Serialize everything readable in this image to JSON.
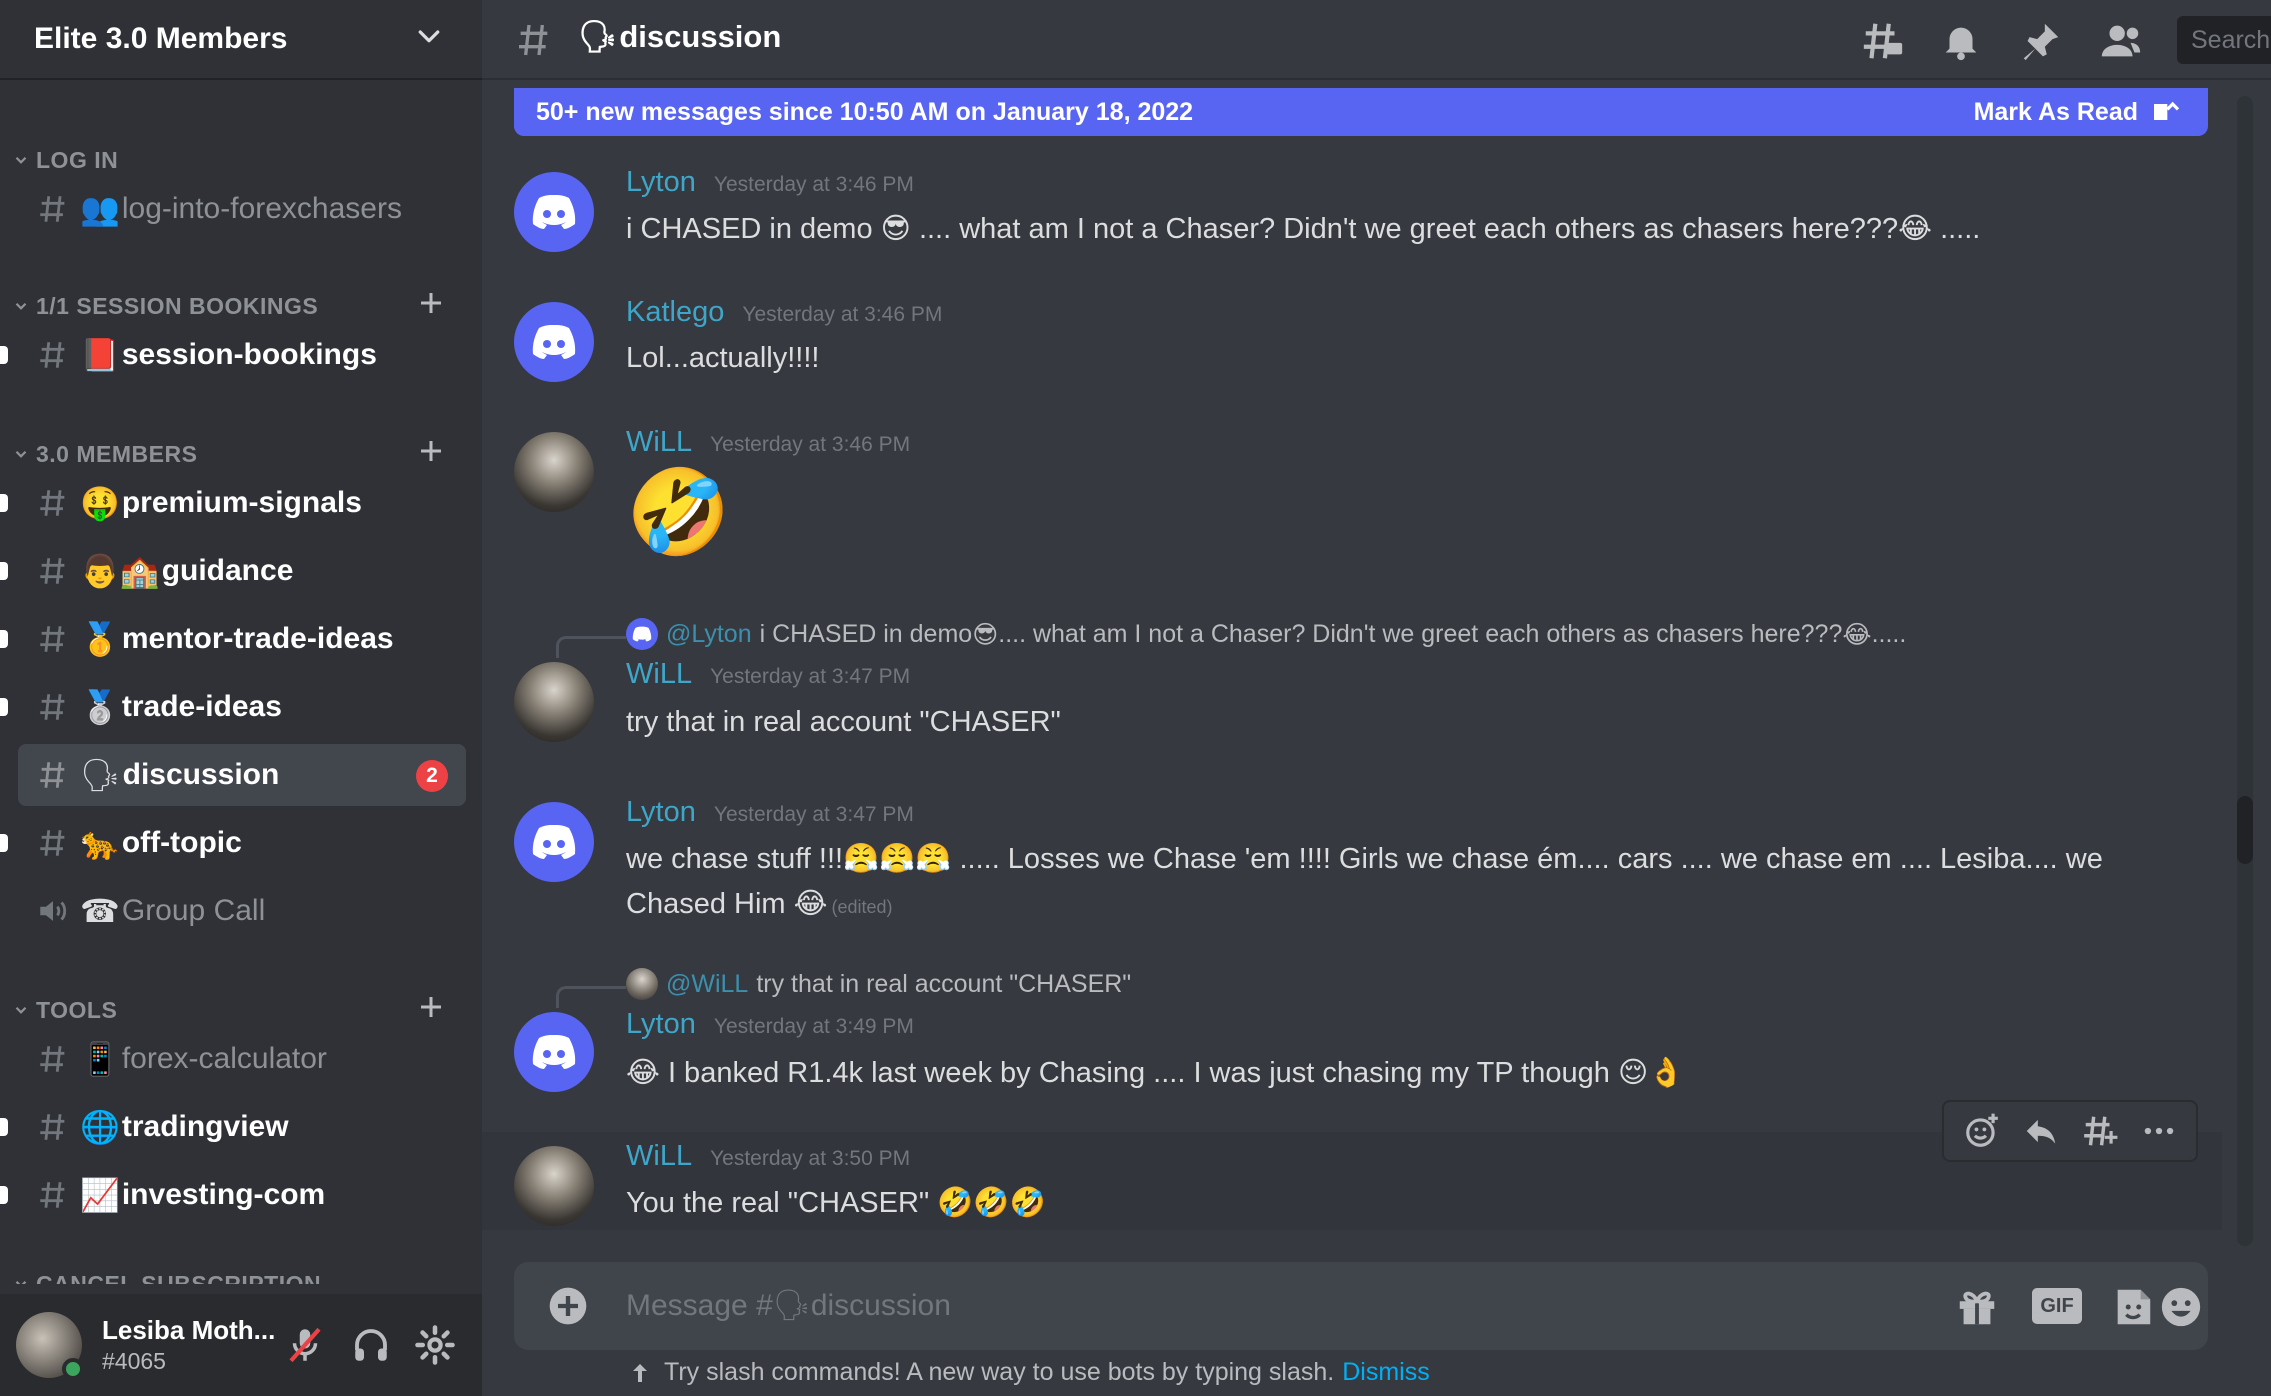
{
  "server": {
    "name": "Elite 3.0 Members"
  },
  "sidebar": {
    "categories": [
      {
        "label": "LOG IN"
      },
      {
        "label": "1/1 SESSION BOOKINGS"
      },
      {
        "label": "3.0 MEMBERS"
      },
      {
        "label": "TOOLS"
      },
      {
        "label": "CANCEL SUBSCRIPTION"
      }
    ],
    "channels": [
      {
        "emoji": "👥",
        "label": "log-into-forexchasers"
      },
      {
        "emoji": "📕",
        "label": "session-bookings"
      },
      {
        "emoji": "🤑",
        "label": "premium-signals"
      },
      {
        "emoji": "👨🏫",
        "label": "guidance"
      },
      {
        "emoji": "🥇",
        "label": "mentor-trade-ideas"
      },
      {
        "emoji": "🥈",
        "label": "trade-ideas"
      },
      {
        "emoji": "🗣",
        "label": "discussion",
        "badge": "2"
      },
      {
        "emoji": "🐆",
        "label": "off-topic"
      },
      {
        "emoji": "☎",
        "label": "Group Call"
      },
      {
        "emoji": "📱",
        "label": "forex-calculator"
      },
      {
        "emoji": "🌐",
        "label": "tradingview"
      },
      {
        "emoji": "📈",
        "label": "investing-com"
      }
    ]
  },
  "user": {
    "name": "Lesiba Moth...",
    "tag": "#4065",
    "status_color": "#3ba55d"
  },
  "header": {
    "channel_emoji": "🗣",
    "channel_name": "discussion",
    "search_placeholder": "Search",
    "icons": [
      "threads-icon",
      "bell-icon",
      "pin-icon",
      "members-icon"
    ]
  },
  "banner": {
    "text": "50+ new messages since 10:50 AM on January 18, 2022",
    "action": "Mark As Read"
  },
  "messages": [
    {
      "author": "Lyton",
      "time": "Yesterday at 3:46 PM",
      "text": [
        "i CHASED in demo ",
        "😎",
        " .... what am I not a Chaser? Didn't we greet each others as chasers here???",
        "😂",
        " ....."
      ]
    },
    {
      "author": "Katlego",
      "time": "Yesterday at 3:46 PM",
      "text": "Lol...actually!!!!"
    },
    {
      "author": "WiLL",
      "time": "Yesterday at 3:46 PM",
      "emoji": "🤣"
    },
    {
      "reply": {
        "user": "@Lyton",
        "parts": [
          "i CHASED in demo ",
          "😎",
          " .... what am I not a Chaser? Didn't we greet each others as chasers here???",
          "😂",
          " ....."
        ]
      },
      "author": "WiLL",
      "time": "Yesterday at 3:47 PM",
      "text": "try that in real account \"CHASER\""
    },
    {
      "author": "Lyton",
      "time": "Yesterday at 3:47 PM",
      "line1": [
        "we chase stuff !!!",
        "😤😤😤",
        " ..... Losses we Chase 'em !!!! Girls we chase ém.... cars .... we chase em .... Lesiba.... we"
      ],
      "line2": [
        "Chased Him ",
        "😂"
      ],
      "edited": "(edited)"
    },
    {
      "reply": {
        "user": "@WiLL",
        "text": "try that in real account \"CHASER\""
      },
      "author": "Lyton",
      "time": "Yesterday at 3:49 PM",
      "text": [
        "😂",
        " I banked R1.4k last week by Chasing .... I was just chasing my TP though ",
        "😌👌"
      ]
    },
    {
      "author": "WiLL",
      "time": "Yesterday at 3:50 PM",
      "text": [
        "You the real \"CHASER\" ",
        "🤣🤣🤣"
      ]
    }
  ],
  "composer": {
    "placeholder": "Message #🗣discussion",
    "gif_label": "GIF",
    "tip": "Try slash commands! A new way to use bots by typing slash.",
    "dismiss": "Dismiss"
  }
}
